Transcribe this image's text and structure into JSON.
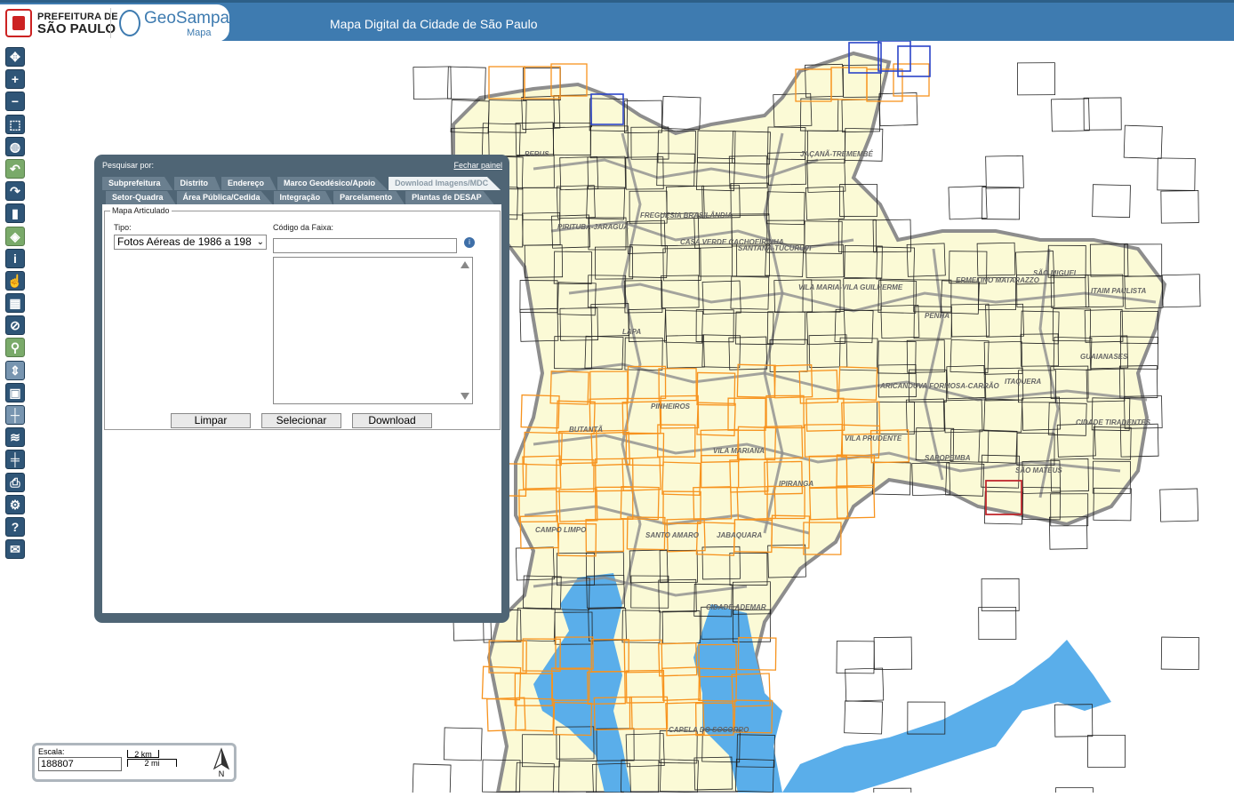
{
  "header": {
    "pref_line1": "PREFEITURA DE",
    "pref_line2": "SÃO PAULO",
    "app_name": "GeoSampa",
    "app_sub": "Mapa",
    "title": "Mapa Digital da Cidade de São Paulo"
  },
  "toolbar": [
    "pan-icon",
    "zoom-in-icon",
    "zoom-out-icon",
    "zoom-box-icon",
    "globe-icon",
    "undo-icon",
    "redo-icon",
    "bookmark-icon",
    "layers-icon",
    "info-icon",
    "pointer-icon",
    "table-icon",
    "no-edit-icon",
    "search-icon",
    "measure-icon",
    "save-icon",
    "ruler-icon",
    "hydro-icon",
    "scalebar-icon",
    "print-icon",
    "settings-icon",
    "help-icon",
    "mail-icon"
  ],
  "toolbar_text": {
    "zoom_in": "+",
    "zoom_out": "−",
    "info": "i",
    "help": "?"
  },
  "panel": {
    "heading": "Pesquisar por:",
    "close": "Fechar painel",
    "tabs_row1": [
      "Subprefeitura",
      "Distrito",
      "Endereço",
      "Marco Geodésico/Apoio",
      "Download Imagens/MDC"
    ],
    "tabs_row2": [
      "Setor-Quadra",
      "Área Pública/Cedida",
      "Integração",
      "Parcelamento",
      "Plantas de DESAP"
    ],
    "active_tab": "Download Imagens/MDC",
    "section": "Mapa Articulado",
    "tipo_label": "Tipo:",
    "tipo_value": "Fotos Aéreas de 1986 a 198",
    "codigo_label": "Código da Faixa:",
    "codigo_value": "",
    "buttons": {
      "clear": "Limpar",
      "select": "Selecionar",
      "download": "Download"
    }
  },
  "map": {
    "labels": [
      "PERUS",
      "JAÇANÃ-TREMEMBÉ",
      "FREGUESIA BRASILÂNDIA",
      "PIRITUBA-JARAGUÁ",
      "CASA VERDE CACHOEIRINHA",
      "SANTANA-TUCURUVI",
      "VILA MARIA-VILA GUILHERME",
      "ERMELINO MATARAZZO",
      "SÃO MIGUEL",
      "ITAIM PAULISTA",
      "PENHA",
      "LAPA",
      "GUAIANASES",
      "ARICANDUVA FORMOSA-CARRÃO",
      "ITAQUERA",
      "PINHEIROS",
      "BUTANTÃ",
      "VILA MARIANA",
      "VILA PRUDENTE",
      "CIDADE TIRADENTES",
      "SAPOPEMBA",
      "SÃO MATEUS",
      "IPIRANGA",
      "CAMPO LIMPO",
      "SANTO AMARO",
      "JABAQUARA",
      "CIDADE ADEMAR",
      "CAPELA DO SOCORRO"
    ],
    "colors": {
      "fill": "#fbfad6",
      "boundary": "#8d8d8d",
      "tile": "#222222",
      "highlight": "#f7931e",
      "selected": "#2b44c8",
      "red": "#c0282d",
      "water": "#5aaeea"
    }
  },
  "scale": {
    "label": "Escala:",
    "value": "188807",
    "km": "2 km",
    "mi": "2 mi",
    "north": "N"
  }
}
